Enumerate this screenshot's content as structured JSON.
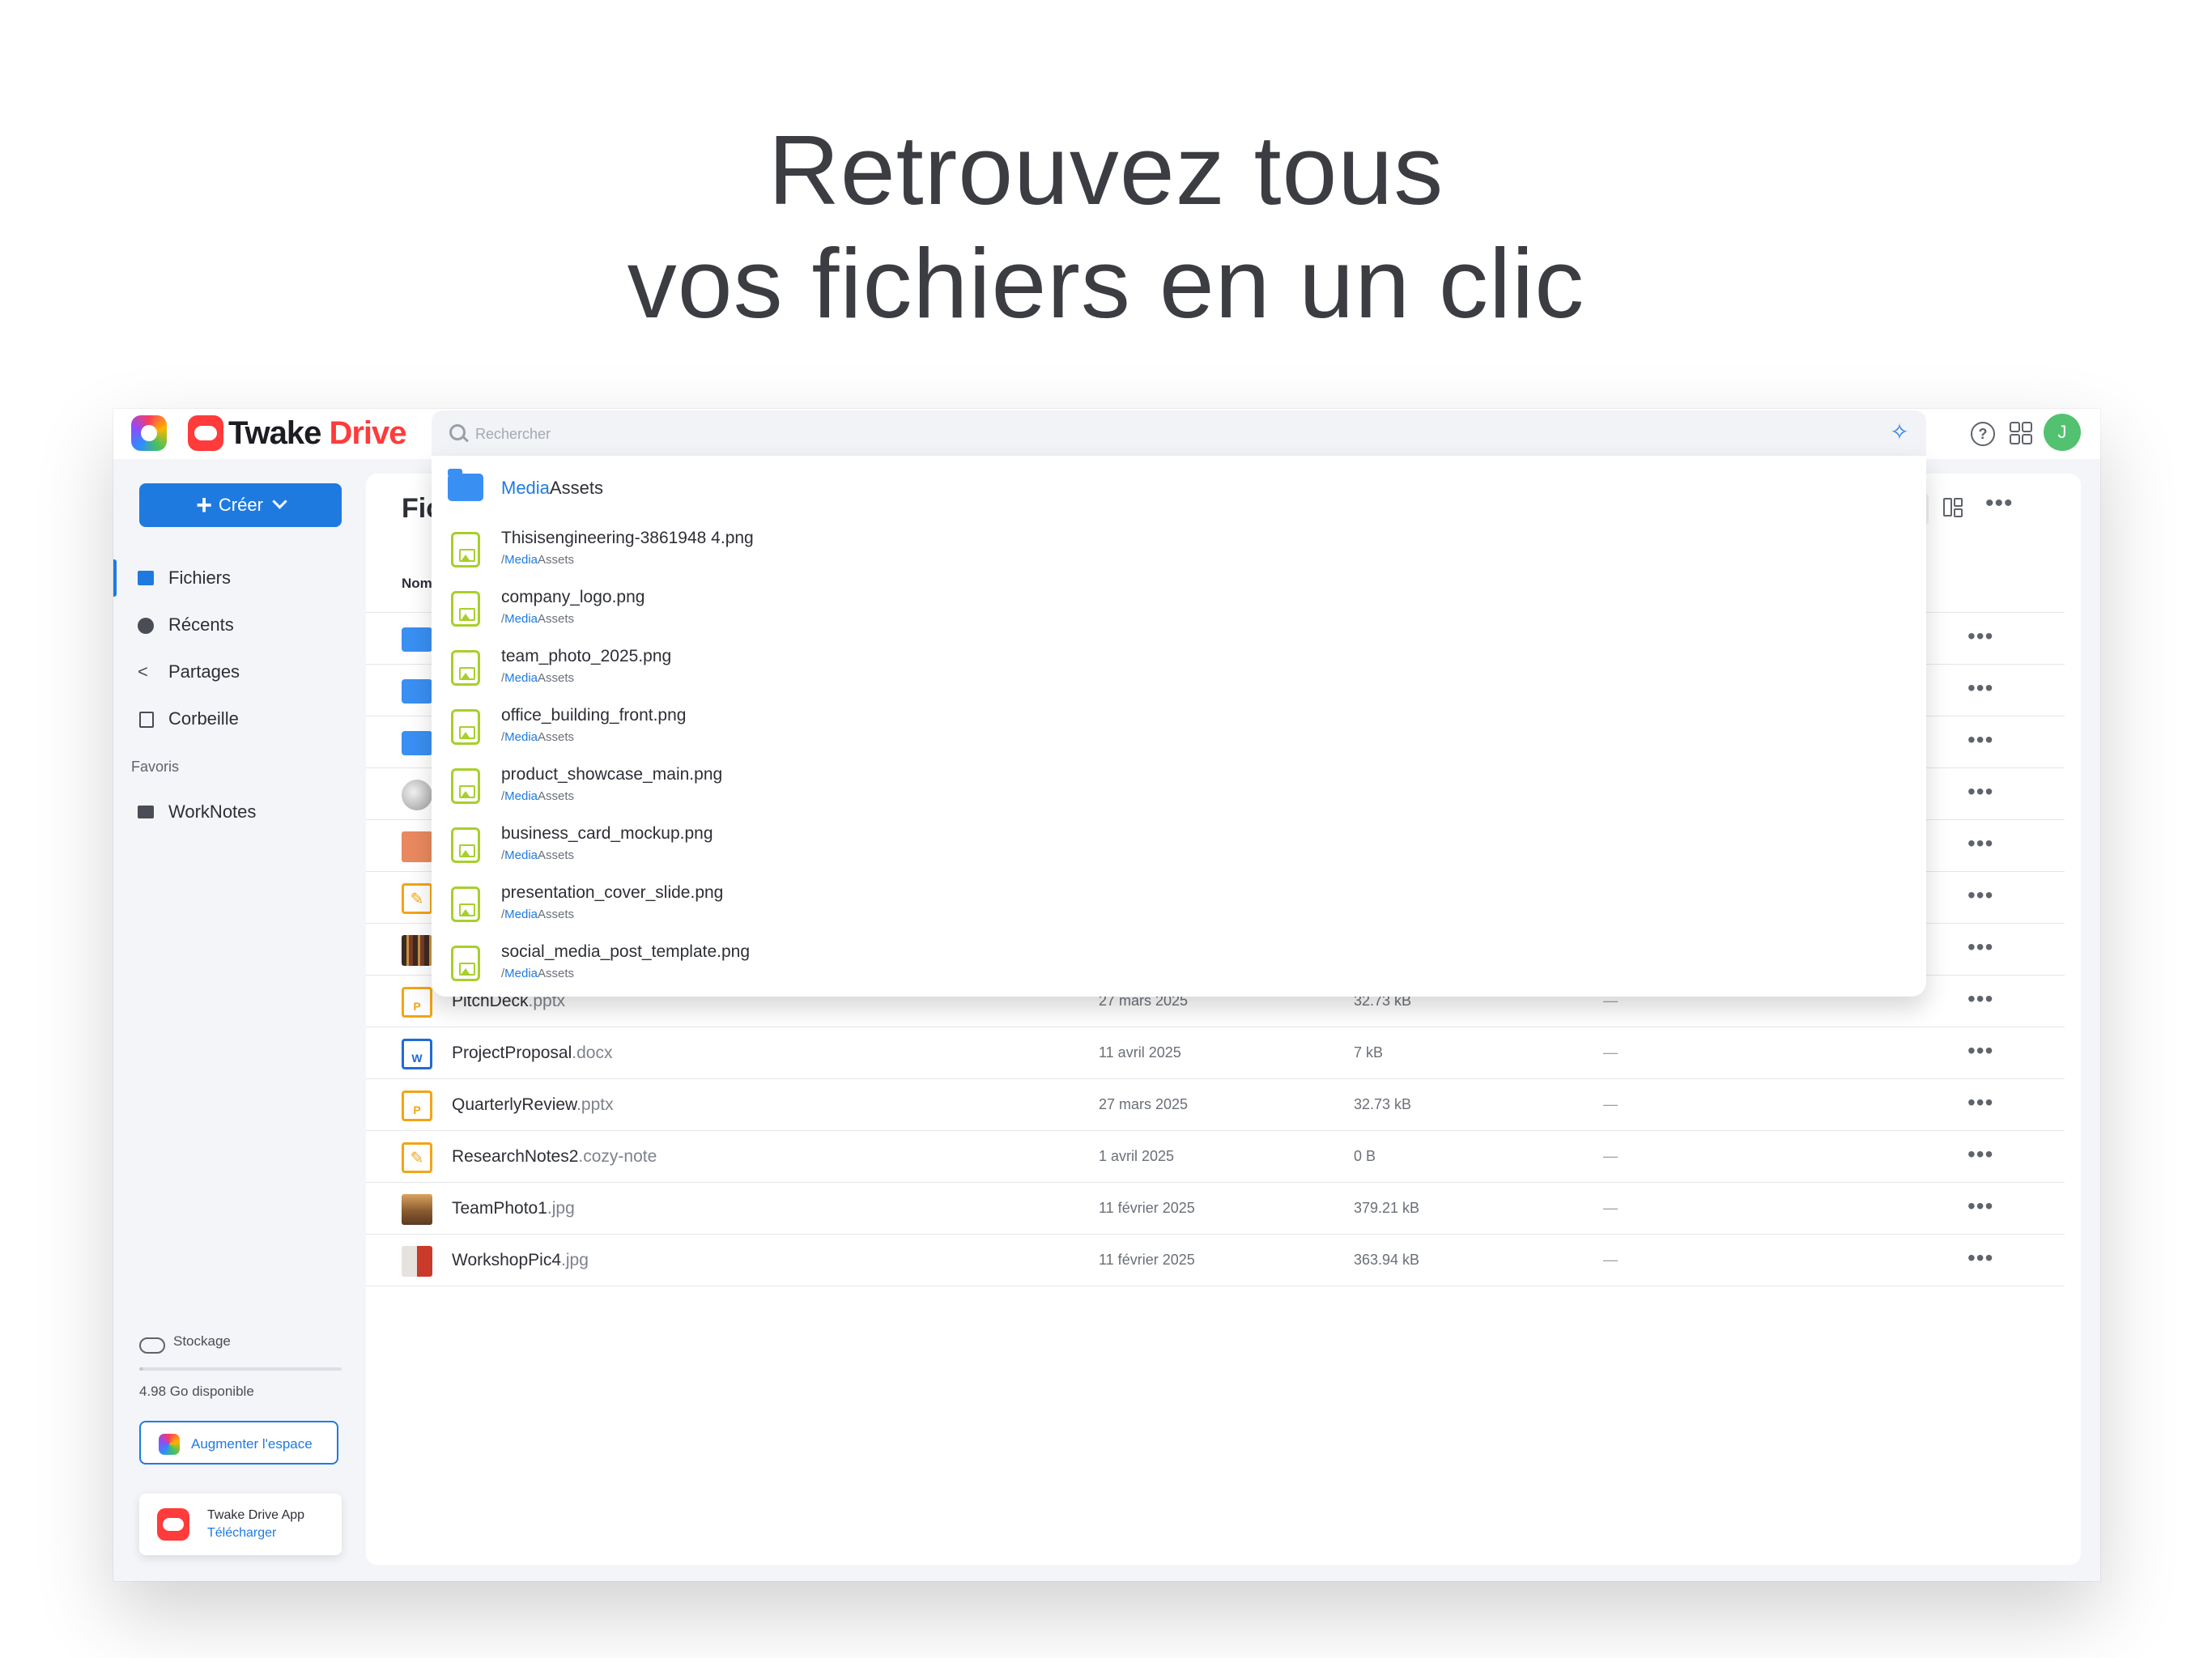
{
  "headline": {
    "line1": "Retrouvez tous",
    "line2": "vos fichiers en un clic"
  },
  "topbar": {
    "brand_part1": "Twake",
    "brand_part2": "Drive",
    "search_placeholder": "Rechercher",
    "avatar_initial": "J",
    "help_glyph": "?",
    "ai_glyph": "✧"
  },
  "sidebar": {
    "create_label": "Créer",
    "items": [
      {
        "label": "Fichiers",
        "icon": "folder-icon"
      },
      {
        "label": "Récents",
        "icon": "clock-icon"
      },
      {
        "label": "Partages",
        "icon": "share-icon"
      },
      {
        "label": "Corbeille",
        "icon": "trash-icon"
      }
    ],
    "favorites_title": "Favoris",
    "favorites": [
      {
        "label": "WorkNotes",
        "icon": "folder-icon"
      }
    ],
    "storage_label": "Stockage",
    "storage_free": "4.98 Go disponible",
    "storage_used_fraction": 0.02,
    "upgrade_label": "Augmenter l'espace",
    "app_title": "Twake Drive App",
    "app_download": "Télécharger"
  },
  "main": {
    "title": "Fic",
    "col_name": "Nom",
    "more_glyph": "•••",
    "rows": [
      {
        "icon": "folder",
        "name": "",
        "ext": "",
        "date": "",
        "size": "",
        "shared": ""
      },
      {
        "icon": "folder",
        "name": "",
        "ext": "",
        "date": "",
        "size": "",
        "shared": ""
      },
      {
        "icon": "folder",
        "name": "",
        "ext": "",
        "date": "",
        "size": "",
        "shared": ""
      },
      {
        "icon": "sphere",
        "name": "",
        "ext": "",
        "date": "",
        "size": "",
        "shared": ""
      },
      {
        "icon": "photo3",
        "name": "",
        "ext": "",
        "date": "",
        "size": "",
        "shared": ""
      },
      {
        "icon": "note",
        "name": "",
        "ext": "",
        "date": "",
        "size": "",
        "shared": ""
      },
      {
        "icon": "photo4",
        "name": "",
        "ext": "",
        "date": "",
        "size": "",
        "shared": ""
      },
      {
        "icon": "pptx",
        "name": "PitchDeck",
        "ext": ".pptx",
        "date": "27 mars 2025",
        "size": "32.73 kB",
        "shared": "—"
      },
      {
        "icon": "docx",
        "name": "ProjectProposal",
        "ext": ".docx",
        "date": "11 avril 2025",
        "size": "7 kB",
        "shared": "—"
      },
      {
        "icon": "pptx",
        "name": "QuarterlyReview",
        "ext": ".pptx",
        "date": "27 mars 2025",
        "size": "32.73 kB",
        "shared": "—"
      },
      {
        "icon": "note",
        "name": "ResearchNotes2",
        "ext": ".cozy-note",
        "date": "1 avril 2025",
        "size": "0 B",
        "shared": "—"
      },
      {
        "icon": "photo1",
        "name": "TeamPhoto1",
        "ext": ".jpg",
        "date": "11 février 2025",
        "size": "379.21 kB",
        "shared": "—"
      },
      {
        "icon": "photo2",
        "name": "WorkshopPic4",
        "ext": ".jpg",
        "date": "11 février 2025",
        "size": "363.94 kB",
        "shared": "—"
      }
    ]
  },
  "dropdown": {
    "folder": {
      "highlight": "Media",
      "rest": "Assets"
    },
    "path_slash": "/",
    "path_highlight": "Media",
    "path_rest": "Assets",
    "items": [
      "Thisisengineering-3861948 4.png",
      "company_logo.png",
      "team_photo_2025.png",
      "office_building_front.png",
      "product_showcase_main.png",
      "business_card_mockup.png",
      "presentation_cover_slide.png",
      "social_media_post_template.png"
    ]
  },
  "colors": {
    "accent": "#1f7ae0",
    "brand_red": "#ff3b3b",
    "image_file_green": "#a8cf2c",
    "folder_blue": "#3a8ff2"
  }
}
